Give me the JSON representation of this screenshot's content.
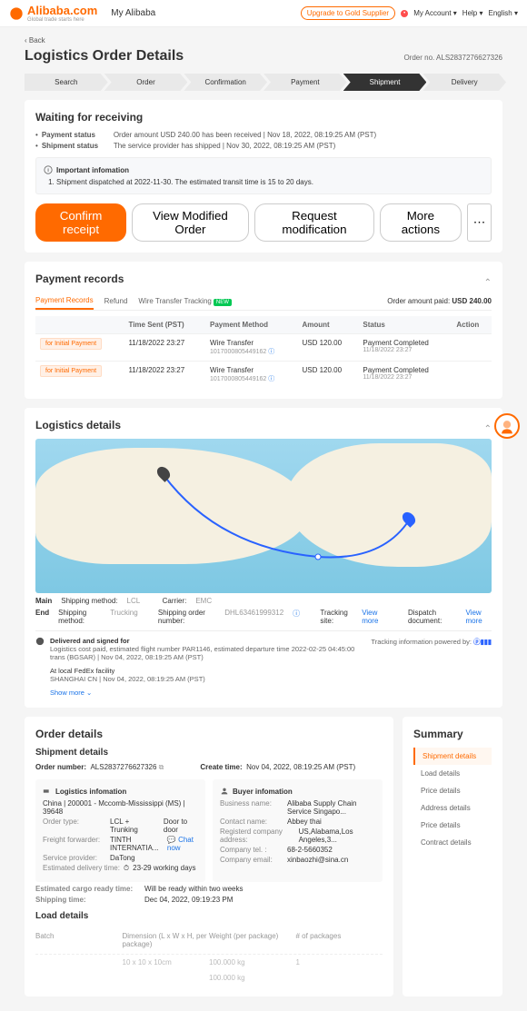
{
  "topbar": {
    "brand": "Alibaba.com",
    "tagline": "Global trade starts here",
    "myalibaba": "My Alibaba",
    "gold": "Upgrade to Gold Supplier",
    "account": "My Account",
    "help": "Help",
    "lang": "English"
  },
  "page": {
    "back": "Back",
    "title": "Logistics Order Details",
    "order_no_label": "Order no.",
    "order_no": "ALS2837276627326"
  },
  "steps": [
    "Search",
    "Order",
    "Confirmation",
    "Payment",
    "Shipment",
    "Delivery"
  ],
  "status": {
    "heading": "Waiting for receiving",
    "payment_label": "Payment status",
    "payment_text": "Order amount USD 240.00 has been received  |  Nov 18, 2022, 08:19:25 AM (PST)",
    "shipment_label": "Shipment status",
    "shipment_text": "The service provider has shipped  |  Nov 30, 2022, 08:19:25 AM (PST)",
    "info_head": "Important infomation",
    "info_item": "Shipment dispatched at 2022-11-30. The estimated transit time is 15 to 20 days.",
    "actions": {
      "confirm": "Confirm receipt",
      "view": "View Modified Order",
      "request": "Request modification",
      "more": "More actions"
    }
  },
  "payment": {
    "heading": "Payment records",
    "tabs": {
      "records": "Payment Records",
      "refund": "Refund",
      "wire": "Wire Transfer Tracking"
    },
    "paid_label": "Order amount paid:",
    "paid_amount": "USD 240.00",
    "columns": [
      "",
      "Time Sent (PST)",
      "Payment Method",
      "Amount",
      "Status",
      "Action"
    ],
    "rows": [
      {
        "tag": "for Initial Payment",
        "time": "11/18/2022 23:27",
        "method": "Wire Transfer",
        "method_sub": "1017000805449162",
        "amount": "USD 120.00",
        "status": "Payment Completed",
        "status_sub": "11/18/2022 23:27"
      },
      {
        "tag": "for Initial Payment",
        "time": "11/18/2022 23:27",
        "method": "Wire Transfer",
        "method_sub": "1017000805449162",
        "amount": "USD 120.00",
        "status": "Payment Completed",
        "status_sub": "11/18/2022 23:27"
      }
    ]
  },
  "logistics": {
    "heading": "Logistics details",
    "main_label": "Main",
    "end_label": "End",
    "ship_method_label": "Shipping method:",
    "main_method": "LCL",
    "carrier_label": "Carrier:",
    "carrier": "EMC",
    "end_method": "Trucking",
    "ship_order_label": "Shipping order number:",
    "ship_order": "DHL63461999312",
    "track_site_label": "Tracking site:",
    "dispatch_label": "Dispatch document:",
    "view_more": "View more",
    "track_head": "Delivered and signed for",
    "track_sub": "Logistics cost paid, estimated flight number PAR1146, estimated departure time 2022-02-25 04:45:00",
    "track_meta": "trans (BGSAR)  |  Nov 04, 2022, 08:19:25 AM (PST)",
    "track_item": "At local FedEx facility",
    "track_item_meta": "SHANGHAI CN  |  Nov 04, 2022, 08:19:25 AM (PST)",
    "powered": "Tracking information powered by:",
    "show_more": "Show more"
  },
  "order": {
    "heading": "Order details",
    "summary": "Summary",
    "side": [
      "Shipment details",
      "Load details",
      "Price details",
      "Address details",
      "Price details",
      "Contract details"
    ],
    "shipment_details": "Shipment details",
    "order_number_label": "Order number:",
    "order_number": "ALS2837276627326",
    "create_label": "Create time:",
    "create_time": "Nov 04, 2022, 08:19:25 AM (PST)",
    "logi_head": "Logistics infomation",
    "buyer_head": "Buyer infomation",
    "logi": {
      "route": "China | 200001 - Mccomb-Mississippi (MS) | 39648",
      "order_type_k": "Order type:",
      "order_type_v": "LCL + Trunking",
      "door": "Door to door",
      "freight_k": "Freight forwarder:",
      "freight_v": "TINTH INTERNATIA...",
      "chat": "Chat now",
      "provider_k": "Service provider:",
      "provider_v": "DaTong",
      "delivery_k": "Estimated delivery time:",
      "delivery_v": "23-29 working days"
    },
    "buyer": {
      "biz_k": "Business name:",
      "biz_v": "Alibaba Supply Chain Service Singapo...",
      "contact_k": "Contact name:",
      "contact_v": "Abbey thai",
      "addr_k": "Registerd company address:",
      "addr_v": "US,Alabama,Los Angeles,3...",
      "tel_k": "Company tel. :",
      "tel_v": "68-2-5660352",
      "email_k": "Company email:",
      "email_v": "xinbaozhi@sina.cn"
    },
    "cargo_k": "Estimated cargo ready time:",
    "cargo_v": "Will be ready within two weeks",
    "shiptime_k": "Shipping time:",
    "shiptime_v": "Dec 04, 2022, 09:19:23 PM",
    "load_details": "Load details",
    "load_cols": [
      "Batch",
      "Dimension (L x W x H, per package)",
      "Weight (per package)",
      "# of packages"
    ],
    "load_rows": [
      [
        "",
        "10 x 10 x 10cm",
        "100.000 kg",
        "1"
      ],
      [
        "",
        "",
        "100.000 kg",
        ""
      ]
    ]
  }
}
